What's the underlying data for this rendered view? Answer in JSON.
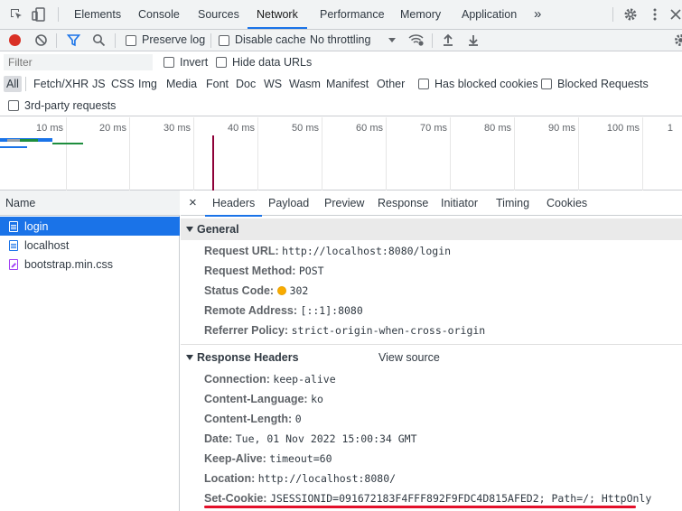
{
  "tabs": [
    "Elements",
    "Console",
    "Sources",
    "Network",
    "Performance",
    "Memory",
    "Application"
  ],
  "tabs_more": "»",
  "toolbar": {
    "preserve_log": "Preserve log",
    "disable_cache": "Disable cache",
    "throttling": "No throttling"
  },
  "filter": {
    "placeholder": "Filter",
    "invert": "Invert",
    "hide_data_urls": "Hide data URLs"
  },
  "types": [
    "All",
    "Fetch/XHR",
    "JS",
    "CSS",
    "Img",
    "Media",
    "Font",
    "Doc",
    "WS",
    "Wasm",
    "Manifest",
    "Other"
  ],
  "has_blocked_cookies": "Has blocked cookies",
  "blocked_requests": "Blocked Requests",
  "third_party": "3rd-party requests",
  "timeline_ticks": [
    "10 ms",
    "20 ms",
    "30 ms",
    "40 ms",
    "50 ms",
    "60 ms",
    "70 ms",
    "80 ms",
    "90 ms",
    "100 ms",
    "1"
  ],
  "list_header": "Name",
  "requests": [
    "login",
    "localhost",
    "bootstrap.min.css"
  ],
  "detail_tabs": [
    "Headers",
    "Payload",
    "Preview",
    "Response",
    "Initiator",
    "Timing",
    "Cookies"
  ],
  "close_glyph": "×",
  "general": {
    "title": "General",
    "rows": [
      {
        "k": "Request URL:",
        "v": "http://localhost:8080/login"
      },
      {
        "k": "Request Method:",
        "v": "POST"
      },
      {
        "k": "Status Code:",
        "v": "302"
      },
      {
        "k": "Remote Address:",
        "v": "[::1]:8080"
      },
      {
        "k": "Referrer Policy:",
        "v": "strict-origin-when-cross-origin"
      }
    ]
  },
  "response_headers": {
    "title": "Response Headers",
    "view_source": "View source",
    "rows": [
      {
        "k": "Connection:",
        "v": "keep-alive"
      },
      {
        "k": "Content-Language:",
        "v": "ko"
      },
      {
        "k": "Content-Length:",
        "v": "0"
      },
      {
        "k": "Date:",
        "v": "Tue, 01 Nov 2022 15:00:34 GMT"
      },
      {
        "k": "Keep-Alive:",
        "v": "timeout=60"
      },
      {
        "k": "Location:",
        "v": "http://localhost:8080/"
      },
      {
        "k": "Set-Cookie:",
        "v": "JSESSIONID=091672183F4FFF892F9FDC4D815AFED2; Path=/; HttpOnly"
      }
    ]
  },
  "colors": {
    "accent": "#1a73e8",
    "record": "#d93025",
    "status_dot": "#f9ab00",
    "underline": "#e3102a"
  }
}
